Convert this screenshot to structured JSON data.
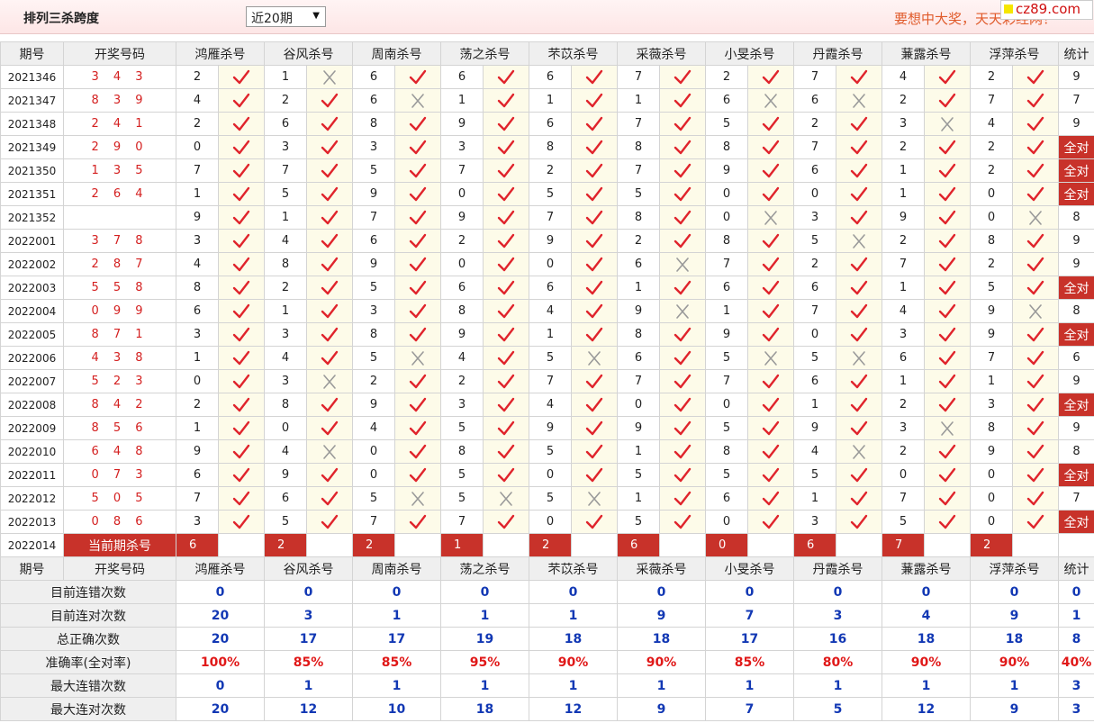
{
  "header": {
    "title": "排列三杀跨度",
    "period_select": "近20期",
    "slogan": "要想中大奖，天天彩经网！",
    "logo": "cz89.com"
  },
  "columns": {
    "period": "期号",
    "draw": "开奖号码",
    "experts": [
      "鸿雁杀号",
      "谷风杀号",
      "周南杀号",
      "荡之杀号",
      "芣苡杀号",
      "采薇杀号",
      "小旻杀号",
      "丹霞杀号",
      "蒹露杀号",
      "浮萍杀号"
    ],
    "stats": "统计"
  },
  "colors": {
    "ok_mark": "#e0242c",
    "no_mark": "#9a9a9a",
    "accent": "#c8322a",
    "blue_value": "#1238b4",
    "red_value": "#e01818"
  },
  "all_correct_label": "全对",
  "rows": [
    {
      "period": "2021346",
      "draw": "3 4 3",
      "kills": [
        2,
        1,
        6,
        6,
        6,
        7,
        2,
        7,
        4,
        2
      ],
      "ok": [
        1,
        0,
        1,
        1,
        1,
        1,
        1,
        1,
        1,
        1
      ],
      "count": "9"
    },
    {
      "period": "2021347",
      "draw": "8 3 9",
      "kills": [
        4,
        2,
        6,
        1,
        1,
        1,
        6,
        6,
        2,
        7
      ],
      "ok": [
        1,
        1,
        0,
        1,
        1,
        1,
        0,
        0,
        1,
        1
      ],
      "count": "7"
    },
    {
      "period": "2021348",
      "draw": "2 4 1",
      "kills": [
        2,
        6,
        8,
        9,
        6,
        7,
        5,
        2,
        3,
        4
      ],
      "ok": [
        1,
        1,
        1,
        1,
        1,
        1,
        1,
        1,
        0,
        1
      ],
      "count": "9"
    },
    {
      "period": "2021349",
      "draw": "2 9 0",
      "kills": [
        0,
        3,
        3,
        3,
        8,
        8,
        8,
        7,
        2,
        2
      ],
      "ok": [
        1,
        1,
        1,
        1,
        1,
        1,
        1,
        1,
        1,
        1
      ],
      "count": "全对"
    },
    {
      "period": "2021350",
      "draw": "1 3 5",
      "kills": [
        7,
        7,
        5,
        7,
        2,
        7,
        9,
        6,
        1,
        2
      ],
      "ok": [
        1,
        1,
        1,
        1,
        1,
        1,
        1,
        1,
        1,
        1
      ],
      "count": "全对"
    },
    {
      "period": "2021351",
      "draw": "2 6 4",
      "kills": [
        1,
        5,
        9,
        0,
        5,
        5,
        0,
        0,
        1,
        0
      ],
      "ok": [
        1,
        1,
        1,
        1,
        1,
        1,
        1,
        1,
        1,
        1
      ],
      "count": "全对"
    },
    {
      "period": "2021352",
      "draw": "",
      "kills": [
        9,
        1,
        7,
        9,
        7,
        8,
        0,
        3,
        9,
        0
      ],
      "ok": [
        1,
        1,
        1,
        1,
        1,
        1,
        0,
        1,
        1,
        0
      ],
      "count": "8"
    },
    {
      "period": "2022001",
      "draw": "3 7 8",
      "kills": [
        3,
        4,
        6,
        2,
        9,
        2,
        8,
        5,
        2,
        8
      ],
      "ok": [
        1,
        1,
        1,
        1,
        1,
        1,
        1,
        0,
        1,
        1
      ],
      "count": "9"
    },
    {
      "period": "2022002",
      "draw": "2 8 7",
      "kills": [
        4,
        8,
        9,
        0,
        0,
        6,
        7,
        2,
        7,
        2
      ],
      "ok": [
        1,
        1,
        1,
        1,
        1,
        0,
        1,
        1,
        1,
        1
      ],
      "count": "9"
    },
    {
      "period": "2022003",
      "draw": "5 5 8",
      "kills": [
        8,
        2,
        5,
        6,
        6,
        1,
        6,
        6,
        1,
        5
      ],
      "ok": [
        1,
        1,
        1,
        1,
        1,
        1,
        1,
        1,
        1,
        1
      ],
      "count": "全对"
    },
    {
      "period": "2022004",
      "draw": "0 9 9",
      "kills": [
        6,
        1,
        3,
        8,
        4,
        9,
        1,
        7,
        4,
        9
      ],
      "ok": [
        1,
        1,
        1,
        1,
        1,
        0,
        1,
        1,
        1,
        0
      ],
      "count": "8"
    },
    {
      "period": "2022005",
      "draw": "8 7 1",
      "kills": [
        3,
        3,
        8,
        9,
        1,
        8,
        9,
        0,
        3,
        9
      ],
      "ok": [
        1,
        1,
        1,
        1,
        1,
        1,
        1,
        1,
        1,
        1
      ],
      "count": "全对"
    },
    {
      "period": "2022006",
      "draw": "4 3 8",
      "kills": [
        1,
        4,
        5,
        4,
        5,
        6,
        5,
        5,
        6,
        7
      ],
      "ok": [
        1,
        1,
        0,
        1,
        0,
        1,
        0,
        0,
        1,
        1
      ],
      "count": "6"
    },
    {
      "period": "2022007",
      "draw": "5 2 3",
      "kills": [
        0,
        3,
        2,
        2,
        7,
        7,
        7,
        6,
        1,
        1
      ],
      "ok": [
        1,
        0,
        1,
        1,
        1,
        1,
        1,
        1,
        1,
        1
      ],
      "count": "9"
    },
    {
      "period": "2022008",
      "draw": "8 4 2",
      "kills": [
        2,
        8,
        9,
        3,
        4,
        0,
        0,
        1,
        2,
        3
      ],
      "ok": [
        1,
        1,
        1,
        1,
        1,
        1,
        1,
        1,
        1,
        1
      ],
      "count": "全对"
    },
    {
      "period": "2022009",
      "draw": "8 5 6",
      "kills": [
        1,
        0,
        4,
        5,
        9,
        9,
        5,
        9,
        3,
        8
      ],
      "ok": [
        1,
        1,
        1,
        1,
        1,
        1,
        1,
        1,
        0,
        1
      ],
      "count": "9"
    },
    {
      "period": "2022010",
      "draw": "6 4 8",
      "kills": [
        9,
        4,
        0,
        8,
        5,
        1,
        8,
        4,
        2,
        9
      ],
      "ok": [
        1,
        0,
        1,
        1,
        1,
        1,
        1,
        0,
        1,
        1
      ],
      "count": "8"
    },
    {
      "period": "2022011",
      "draw": "0 7 3",
      "kills": [
        6,
        9,
        0,
        5,
        0,
        5,
        5,
        5,
        0,
        0
      ],
      "ok": [
        1,
        1,
        1,
        1,
        1,
        1,
        1,
        1,
        1,
        1
      ],
      "count": "全对"
    },
    {
      "period": "2022012",
      "draw": "5 0 5",
      "kills": [
        7,
        6,
        5,
        5,
        5,
        1,
        6,
        1,
        7,
        0
      ],
      "ok": [
        1,
        1,
        0,
        0,
        0,
        1,
        1,
        1,
        1,
        1
      ],
      "count": "7"
    },
    {
      "period": "2022013",
      "draw": "0 8 6",
      "kills": [
        3,
        5,
        7,
        7,
        0,
        5,
        0,
        3,
        5,
        0
      ],
      "ok": [
        1,
        1,
        1,
        1,
        1,
        1,
        1,
        1,
        1,
        1
      ],
      "count": "全对"
    }
  ],
  "current": {
    "period": "2022014",
    "label": "当前期杀号",
    "kills": [
      "6",
      "2",
      "2",
      "1",
      "2",
      "6",
      "0",
      "6",
      "7",
      "2"
    ]
  },
  "stats": [
    {
      "label": "目前连错次数",
      "values": [
        "0",
        "0",
        "0",
        "0",
        "0",
        "0",
        "0",
        "0",
        "0",
        "0"
      ],
      "total": "0"
    },
    {
      "label": "目前连对次数",
      "values": [
        "20",
        "3",
        "1",
        "1",
        "1",
        "9",
        "7",
        "3",
        "4",
        "9"
      ],
      "total": "1"
    },
    {
      "label": "总正确次数",
      "values": [
        "20",
        "17",
        "17",
        "19",
        "18",
        "18",
        "17",
        "16",
        "18",
        "18"
      ],
      "total": "8"
    },
    {
      "label": "准确率(全对率)",
      "values": [
        "100%",
        "85%",
        "85%",
        "95%",
        "90%",
        "90%",
        "85%",
        "80%",
        "90%",
        "90%"
      ],
      "total": "40%",
      "red": true
    },
    {
      "label": "最大连错次数",
      "values": [
        "0",
        "1",
        "1",
        "1",
        "1",
        "1",
        "1",
        "1",
        "1",
        "1"
      ],
      "total": "3"
    },
    {
      "label": "最大连对次数",
      "values": [
        "20",
        "12",
        "10",
        "18",
        "12",
        "9",
        "7",
        "5",
        "12",
        "9"
      ],
      "total": "3"
    }
  ]
}
